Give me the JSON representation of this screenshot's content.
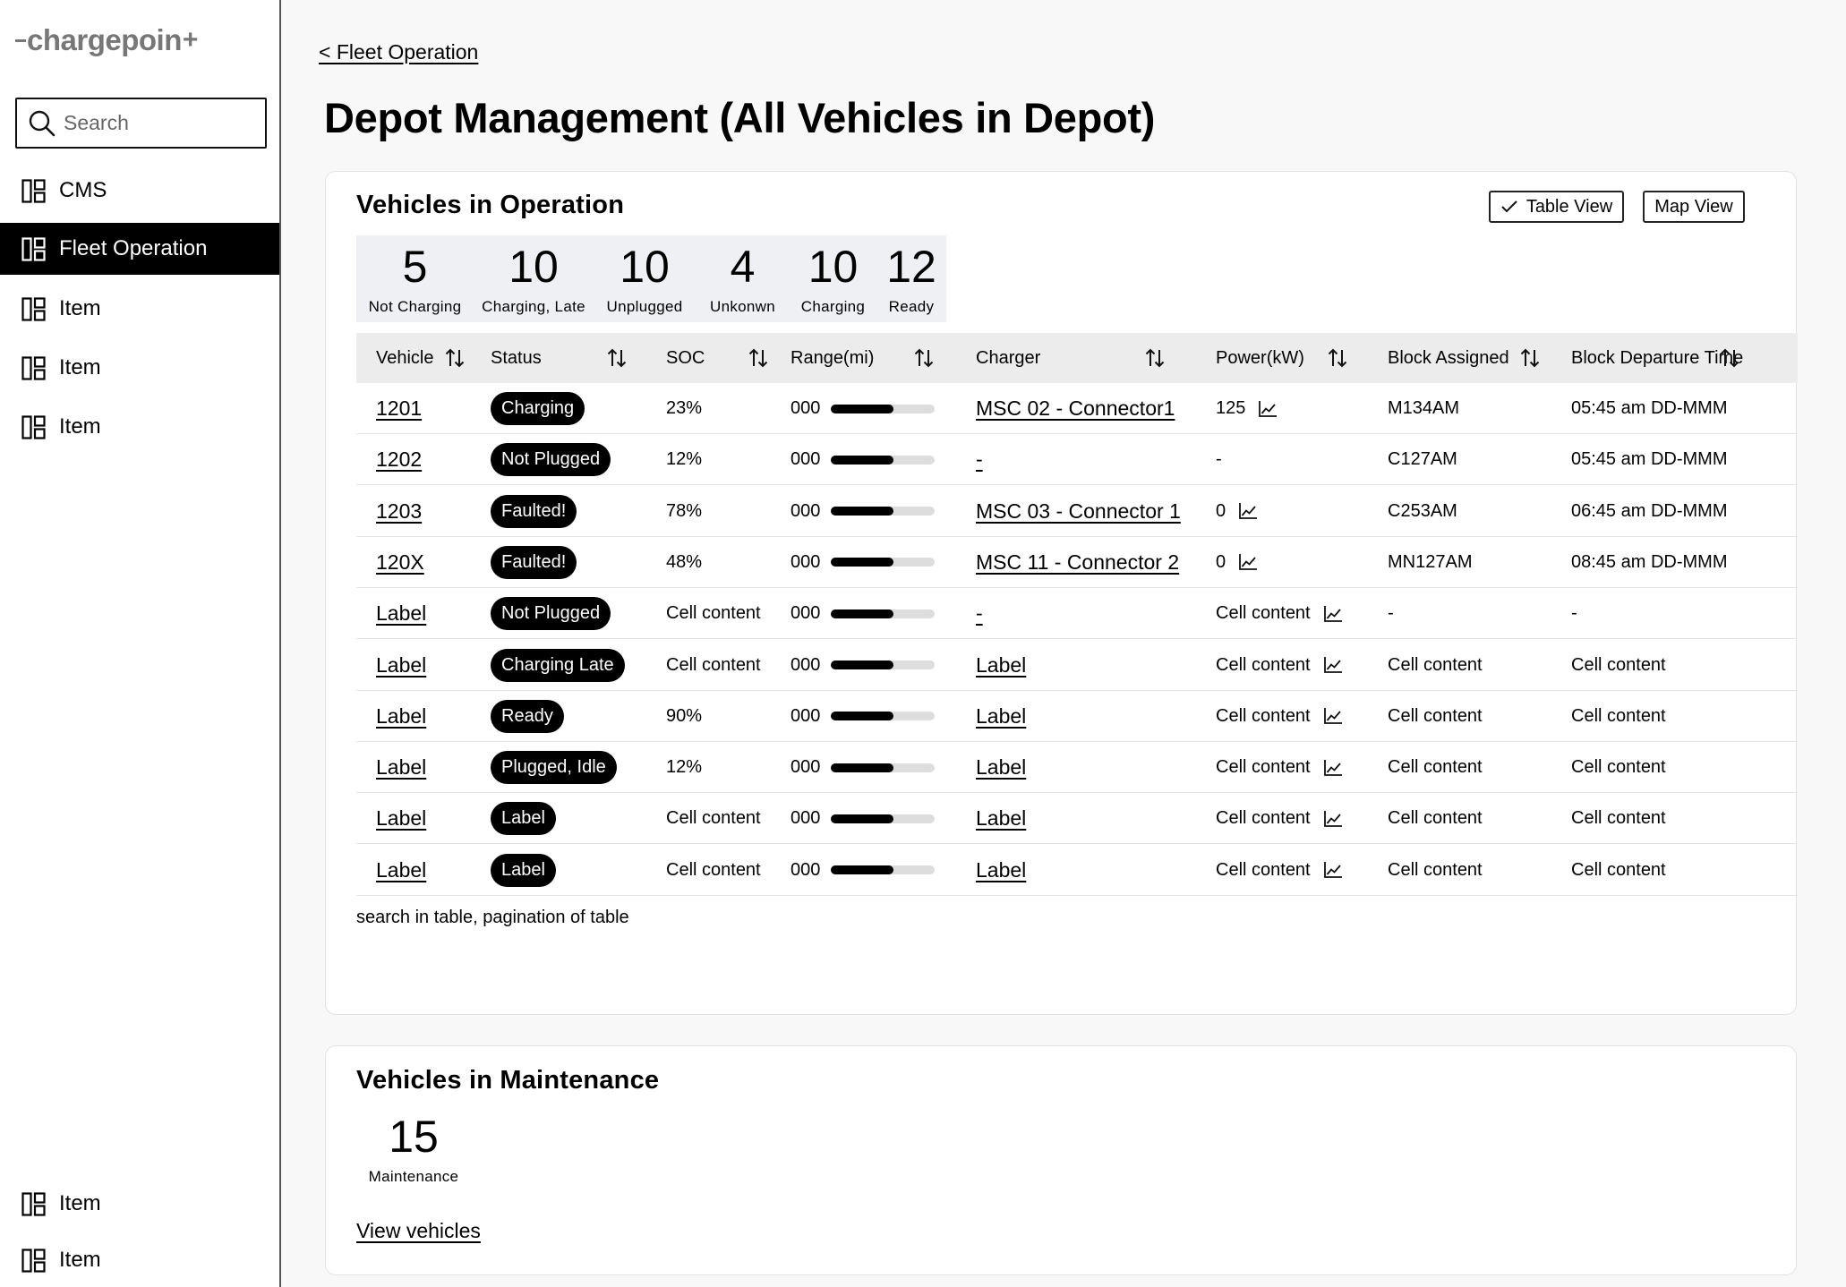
{
  "brand": {
    "logo_text": "chargepoin"
  },
  "sidebar": {
    "search_placeholder": "Search",
    "items": [
      {
        "label": "CMS"
      },
      {
        "label": "Fleet Operation",
        "active": true
      },
      {
        "label": "Item"
      },
      {
        "label": "Item"
      },
      {
        "label": "Item"
      }
    ],
    "bottom_items": [
      {
        "label": "Item"
      },
      {
        "label": "Item"
      }
    ]
  },
  "breadcrumb": "< Fleet Operation",
  "page_title": "Depot Management (All Vehicles in Depot)",
  "operation": {
    "title": "Vehicles in Operation",
    "table_view_label": "Table View",
    "table_view_selected": true,
    "map_view_label": "Map View",
    "stats": [
      {
        "value": "5",
        "label": "Not Charging"
      },
      {
        "value": "10",
        "label": "Charging, Late"
      },
      {
        "value": "10",
        "label": "Unplugged"
      },
      {
        "value": "4",
        "label": "Unkonwn"
      },
      {
        "value": "10",
        "label": "Charging"
      },
      {
        "value": "12",
        "label": "Ready"
      }
    ],
    "columns": [
      "Vehicle",
      "Status",
      "SOC",
      "Range(mi)",
      "Charger",
      "Power(kW)",
      "Block Assigned",
      "Block Departure Time"
    ],
    "rows": [
      {
        "vehicle": "1201",
        "status": "Charging",
        "soc": "23%",
        "range": "000",
        "range_fill": 0.6,
        "charger": "MSC 02 - Connector1",
        "power": "125",
        "block": "M134AM",
        "departure": "05:45 am DD-MMM"
      },
      {
        "vehicle": "1202",
        "status": "Not Plugged",
        "soc": "12%",
        "range": "000",
        "range_fill": 0.6,
        "charger": "-",
        "power": "-",
        "block": "C127AM",
        "departure": "05:45 am DD-MMM"
      },
      {
        "vehicle": "1203",
        "status": "Faulted!",
        "soc": "78%",
        "range": "000",
        "range_fill": 0.6,
        "charger": "MSC 03 - Connector 1",
        "power": "0",
        "block": "C253AM",
        "departure": "06:45 am DD-MMM"
      },
      {
        "vehicle": "120X",
        "status": "Faulted!",
        "soc": "48%",
        "range": "000",
        "range_fill": 0.6,
        "charger": "MSC 11 - Connector 2",
        "power": "0",
        "block": "MN127AM",
        "departure": "08:45 am DD-MMM"
      },
      {
        "vehicle": "Label",
        "status": "Not Plugged",
        "soc": "Cell content",
        "range": "000",
        "range_fill": 0.6,
        "charger": "-",
        "power": "Cell content",
        "block": "-",
        "departure": "-"
      },
      {
        "vehicle": "Label",
        "status": "Charging Late",
        "soc": "Cell content",
        "range": "000",
        "range_fill": 0.6,
        "charger": "Label",
        "power": "Cell content",
        "block": "Cell content",
        "departure": "Cell content"
      },
      {
        "vehicle": "Label",
        "status": "Ready",
        "soc": "90%",
        "range": "000",
        "range_fill": 0.6,
        "charger": "Label",
        "power": "Cell content",
        "block": "Cell content",
        "departure": "Cell content"
      },
      {
        "vehicle": "Label",
        "status": "Plugged, Idle",
        "soc": "12%",
        "range": "000",
        "range_fill": 0.6,
        "charger": "Label",
        "power": "Cell content",
        "block": "Cell content",
        "departure": "Cell content"
      },
      {
        "vehicle": "Label",
        "status": "Label",
        "soc": "Cell content",
        "range": "000",
        "range_fill": 0.6,
        "charger": "Label",
        "power": "Cell content",
        "block": "Cell content",
        "departure": "Cell content"
      },
      {
        "vehicle": "Label",
        "status": "Label",
        "soc": "Cell content",
        "range": "000",
        "range_fill": 0.6,
        "charger": "Label",
        "power": "Cell content",
        "block": "Cell content",
        "departure": "Cell content"
      }
    ],
    "table_note": "search in table, pagination of table"
  },
  "maintenance": {
    "title": "Vehicles in Maintenance",
    "count": "15",
    "count_label": "Maintenance",
    "view_link": "View vehicles"
  }
}
